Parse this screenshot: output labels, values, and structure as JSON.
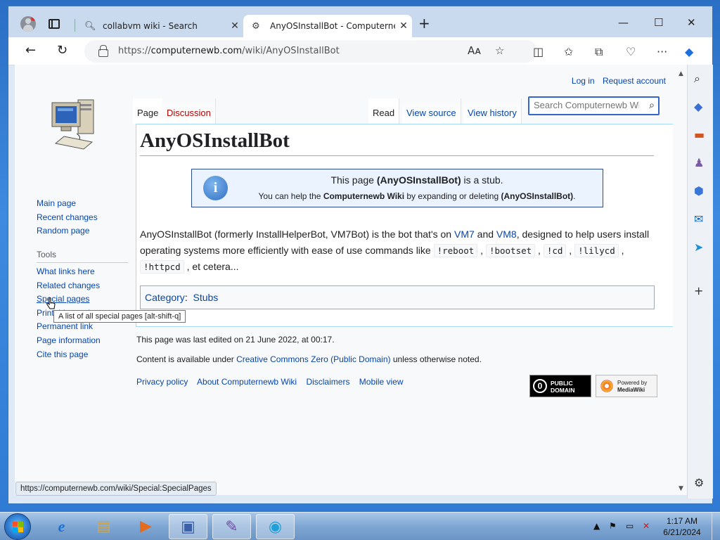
{
  "browser": {
    "tabs": [
      {
        "title": "collabvm wiki - Search",
        "icon": "search-icon",
        "active": false
      },
      {
        "title": "AnyOSInstallBot - Computernewb Wiki",
        "icon": "wiki-icon",
        "active": true
      }
    ],
    "url_prefix": "https://",
    "url_host": "computernewb.com",
    "url_path": "/wiki/AnyOSInstallBot",
    "status_url": "https://computernewb.com/wiki/Special:SpecialPages"
  },
  "wiki": {
    "user_links": [
      "Log in",
      "Request account"
    ],
    "nav_links": [
      "Main page",
      "Recent changes",
      "Random page"
    ],
    "tools_heading": "Tools",
    "tool_links": [
      "What links here",
      "Related changes",
      "Special pages",
      "Printable version",
      "Permanent link",
      "Page information",
      "Cite this page"
    ],
    "tooltip": "A list of all special pages [alt-shift-q]",
    "tabs_left": [
      "Page",
      "Discussion"
    ],
    "tabs_right": [
      "Read",
      "View source",
      "View history"
    ],
    "search_placeholder": "Search Computernewb Wiki",
    "title": "AnyOSInstallBot",
    "stub": {
      "l1_a": "This page ",
      "l1_b": "(AnyOSInstallBot)",
      "l1_c": " is a stub.",
      "l2_a": "You can help the ",
      "l2_b": "Computernewb Wiki",
      "l2_c": " by expanding or deleting ",
      "l2_d": "(AnyOSInstallBot)",
      "l2_e": "."
    },
    "body": {
      "t1": "AnyOSInstallBot (formerly InstallHelperBot, VM7Bot) is the bot that's on ",
      "vm7": "VM7",
      "t2": " and ",
      "vm8": "VM8",
      "t3": ", designed to help users install operating systems more efficiently with ease of use commands like ",
      "cmds": [
        "!reboot",
        "!bootset",
        "!cd",
        "!lilycd",
        "!httpcd"
      ],
      "sep": " , ",
      "t4": " , et cetera..."
    },
    "category_label": "Category",
    "category_colon": ":",
    "category": "Stubs",
    "footer": {
      "edited": "This page was last edited on 21 June 2022, at 00:17.",
      "license_a": "Content is available under ",
      "license_link": "Creative Commons Zero (Public Domain)",
      "license_b": " unless otherwise noted.",
      "links": [
        "Privacy policy",
        "About Computernewb Wiki",
        "Disclaimers",
        "Mobile view"
      ],
      "badge_pd": [
        "PUBLIC",
        "DOMAIN"
      ],
      "badge_mw": [
        "Powered by",
        "MediaWiki"
      ]
    }
  },
  "taskbar": {
    "time": "1:17 AM",
    "date": "6/21/2024"
  },
  "colors": {
    "link": "#0645ad",
    "redlink": "#ba0000",
    "accent": "#3366cc"
  }
}
